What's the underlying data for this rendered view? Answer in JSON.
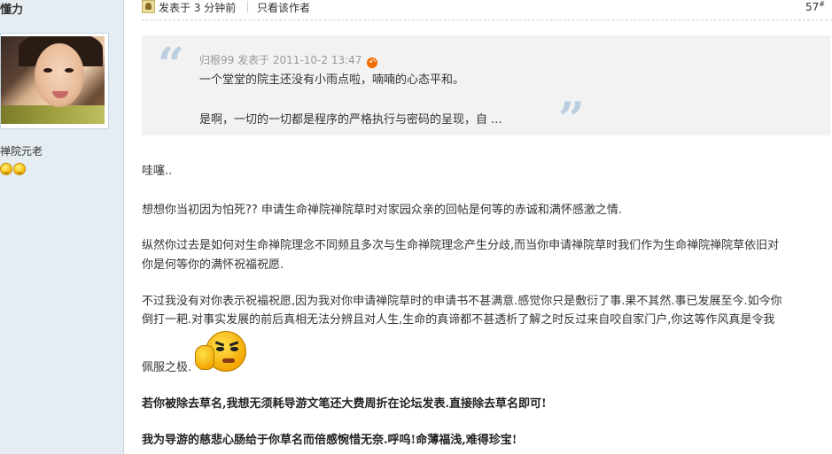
{
  "sidebar": {
    "author_name": "懂力",
    "user_group": "禅院元老"
  },
  "post_header": {
    "posted_time": "发表于 3 分钟前",
    "author_only": "只看该作者",
    "floor": "57",
    "floor_mark": "#"
  },
  "quote": {
    "meta": "归根99 发表于 2011-10-2 13:47",
    "line1": "一个堂堂的院主还没有小雨点啦，喃喃的心态平和。",
    "line2": "是啊，一切的一切都是程序的严格执行与密码的呈现，自 ..."
  },
  "body": {
    "p1": "哇噻..",
    "p2": "想想你当初因为怕死?? 申请生命禅院禅院草时对家园众亲的回帖是何等的赤诚和满怀感激之情.",
    "p3a": "纵然你过去是如何对生命禅院理念不同频且多次与生命禅院理念产生分歧,而当你申请禅院草时我们作为生命禅院禅院草依旧对",
    "p3b": "你是何等你的满怀祝福祝愿.",
    "p4a": "不过我没有对你表示祝福祝愿,因为我对你申请禅院草时的申请书不甚满意.感觉你只是敷衍了事.果不其然.事已发展至今.如今你",
    "p4b": "倒打一耙.对事实发展的前后真相无法分辨且对人生,生命的真谛都不甚透析了解之时反过来自咬自家门户,你这等作风真是令我",
    "p4c": "佩服之极.",
    "p5": "若你被除去草名,我想无须耗导游文笔还大费周折在论坛发表.直接除去草名即可!",
    "p6": "我为导游的慈悲心肠给于你草名而倍感惋惜无奈.呼呜!命薄福浅,难得珍宝!"
  },
  "colors": {
    "sidebar_bg": "#e5edf2",
    "quote_bg": "#f2f2f2",
    "quote_mark": "#bccfe0",
    "reply_icon": "#f06a00"
  },
  "icons": [
    "user-post-icon",
    "reply-arrow-icon",
    "smiley-icon",
    "thumbs-up-emoticon"
  ]
}
